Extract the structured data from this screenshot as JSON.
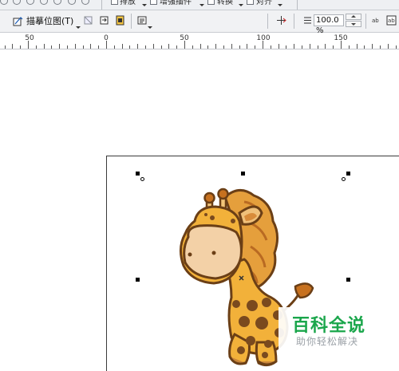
{
  "toolbar_top": {
    "arrange_label": "排放",
    "plugins_label": "增强插件",
    "transform_label": "转换",
    "align_label": "对齐"
  },
  "property_bar": {
    "trace_bitmap_label": "描摹位图(T)",
    "zoom_value": "100.0 %"
  },
  "ruler": {
    "labels": [
      "50",
      "0",
      "50",
      "100",
      "150"
    ]
  },
  "watermark": {
    "title": "百科全说",
    "subtitle": "助你轻松解决"
  },
  "colors": {
    "accent_green": "#1aa64b",
    "giraffe_body": "#f2b13a",
    "giraffe_spots": "#7a4a1e",
    "giraffe_face": "#f3d1a7"
  }
}
